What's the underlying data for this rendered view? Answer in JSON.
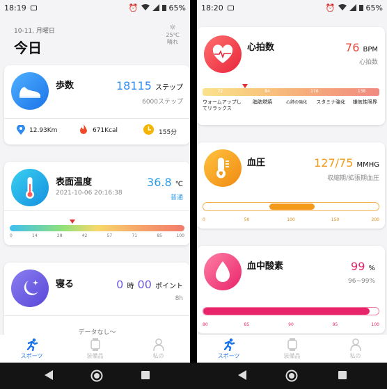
{
  "status_left": {
    "time": "18:19",
    "battery": "65%"
  },
  "status_right": {
    "time": "18:20",
    "battery": "65%"
  },
  "header": {
    "date": "10-11, 月曜日",
    "title": "今日",
    "temp": "25℃",
    "weather": "晴れ",
    "weather_icon": "sun-icon"
  },
  "steps": {
    "title": "歩数",
    "value": "18115",
    "unit": "ステップ",
    "goal": "6000ステップ",
    "distance": "12.93Km",
    "calories": "671Kcal",
    "minutes": "155分",
    "icon": "sneaker-icon",
    "color": "#2f8cf0"
  },
  "surface_temp": {
    "title": "表面温度",
    "value": "36.8",
    "unit": "℃",
    "timestamp": "2021-10-06 20:16:38",
    "status": "普通",
    "ticks": [
      "0",
      "14",
      "28",
      "42",
      "57",
      "71",
      "85",
      "100"
    ],
    "marker_fraction": 0.36,
    "color": "#2e9be5"
  },
  "sleep": {
    "title": "寝る",
    "hours": "0",
    "hours_unit": "時",
    "minutes": "00",
    "minutes_unit": "ポイント",
    "goal": "8h",
    "no_data": "データなし～",
    "color": "#6b5be0"
  },
  "heart": {
    "title": "心拍数",
    "value": "76",
    "unit": "BPM",
    "sublabel": "心拍数",
    "ticks": [
      "72",
      "84",
      "116",
      "138"
    ],
    "zones": [
      "ウォームアップしてリラックス",
      "脂肪燃焼",
      "心肺の強化",
      "スタミナ強化",
      "嫌気性限界"
    ],
    "marker_fraction": 0.24,
    "color": "#e8463a"
  },
  "blood_pressure": {
    "title": "血圧",
    "value": "127/75",
    "unit": "MMHG",
    "sublabel": "収縮期/拡張期血圧",
    "ticks": [
      "0",
      "50",
      "100",
      "150",
      "200"
    ],
    "range_low": 75,
    "range_high": 127,
    "color": "#f39a1a"
  },
  "spo2": {
    "title": "血中酸素",
    "value": "99",
    "unit": "%",
    "sublabel": "96~99%",
    "ticks": [
      "80",
      "85",
      "90",
      "95",
      "100"
    ],
    "fill_fraction": 0.95,
    "color": "#e8246a"
  },
  "nav": {
    "sports": "スポーツ",
    "device": "装備品",
    "me": "私の"
  }
}
